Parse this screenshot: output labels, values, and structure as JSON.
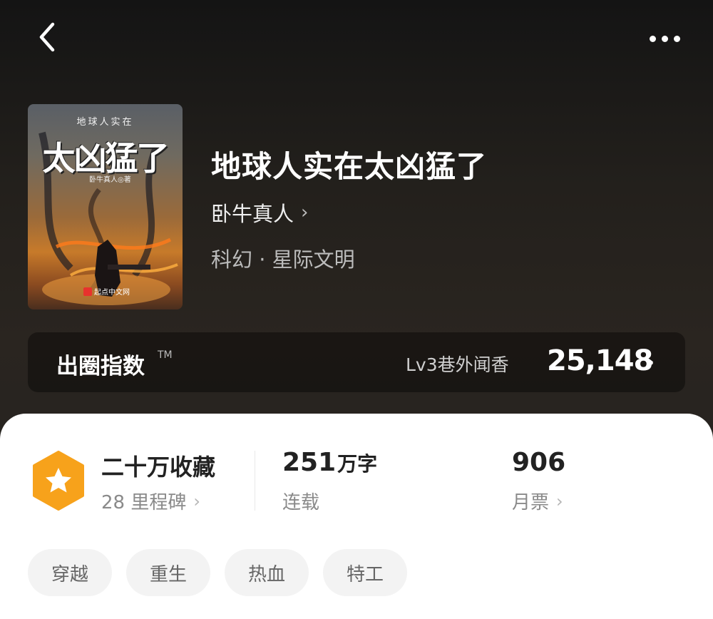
{
  "header": {
    "back_icon": "chevron-left-icon",
    "more_icon": "more-horizontal-icon"
  },
  "book": {
    "title": "地球人实在太凶猛了",
    "author": "卧牛真人",
    "genre": "科幻 · 星际文明",
    "cover": {
      "top_text": "地球人实在",
      "title_text": "太凶猛了",
      "author_text": "卧牛真人◎著",
      "publisher_text": "起点中文网"
    }
  },
  "influence": {
    "label": "出圈指数",
    "tm": "TM",
    "level": "Lv3巷外闻香",
    "value": "25,148"
  },
  "stats": {
    "favorites": {
      "title": "二十万收藏",
      "sub": "28 里程碑"
    },
    "words": {
      "value": "251",
      "unit": "万字",
      "sub": "连载"
    },
    "votes": {
      "value": "906",
      "sub": "月票"
    }
  },
  "tags": [
    "穿越",
    "重生",
    "热血",
    "特工"
  ],
  "colors": {
    "badge": "#f7a21b",
    "card_bg": "#ffffff",
    "tag_bg": "#f3f3f3"
  }
}
